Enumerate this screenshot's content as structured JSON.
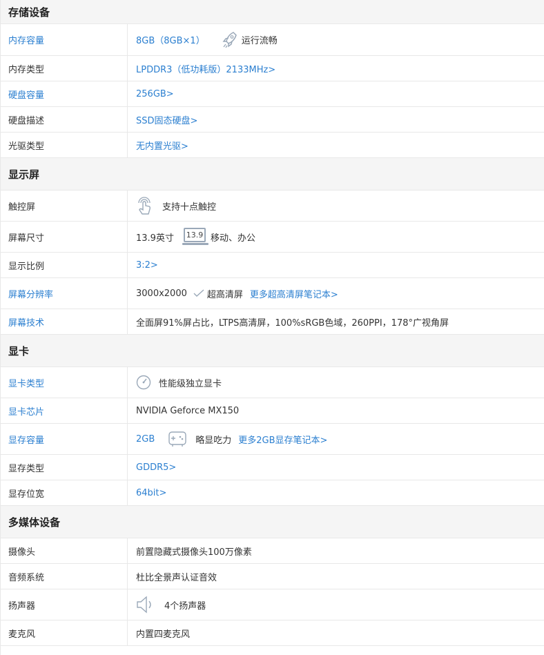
{
  "storage": {
    "title": "存储设备",
    "memory_capacity": {
      "label": "内存容量",
      "value": "8GB（8GB×1）",
      "badge": "运行流畅",
      "icon": "rocket-icon"
    },
    "memory_type": {
      "label": "内存类型",
      "value": "LPDDR3（低功耗版）2133MHz>"
    },
    "disk_capacity": {
      "label": "硬盘容量",
      "value": "256GB>"
    },
    "disk_desc": {
      "label": "硬盘描述",
      "value": "SSD固态硬盘>"
    },
    "optical": {
      "label": "光驱类型",
      "value": "无内置光驱>"
    }
  },
  "display": {
    "title": "显示屏",
    "touch": {
      "label": "触控屏",
      "value": "支持十点触控",
      "icon": "touch-hand-icon"
    },
    "size": {
      "label": "屏幕尺寸",
      "value": "13.9英寸",
      "badge_number": "13.9",
      "badge": "移动、办公"
    },
    "ratio": {
      "label": "显示比例",
      "value": "3:2>"
    },
    "resolution": {
      "label": "屏幕分辨率",
      "value": "3000x2000",
      "badge": "超高清屏",
      "more": "更多超高清屏笔记本>"
    },
    "tech": {
      "label": "屏幕技术",
      "value": "全面屏91%屏占比，LTPS高清屏，100%sRGB色域，260PPI，178°广视角屏"
    }
  },
  "gpu": {
    "title": "显卡",
    "type": {
      "label": "显卡类型",
      "value": "性能级独立显卡",
      "icon": "gauge-icon"
    },
    "chip": {
      "label": "显卡芯片",
      "value": "NVIDIA Geforce MX150"
    },
    "vram": {
      "label": "显存容量",
      "value": "2GB",
      "badge": "略显吃力",
      "more": "更多2GB显存笔记本>",
      "icon": "gamepad-icon"
    },
    "vram_type": {
      "label": "显存类型",
      "value": "GDDR5>"
    },
    "bus": {
      "label": "显存位宽",
      "value": "64bit>"
    }
  },
  "multimedia": {
    "title": "多媒体设备",
    "camera": {
      "label": "摄像头",
      "value": "前置隐藏式摄像头100万像素"
    },
    "audio": {
      "label": "音频系统",
      "value": "杜比全景声认证音效"
    },
    "speaker": {
      "label": "扬声器",
      "value": "4个扬声器",
      "icon": "speaker-icon"
    },
    "mic": {
      "label": "麦克风",
      "value": "内置四麦克风"
    }
  },
  "colors": {
    "link": "#2b7fd0",
    "header_bg": "#f5f5f5",
    "border": "#e8e8e8"
  }
}
